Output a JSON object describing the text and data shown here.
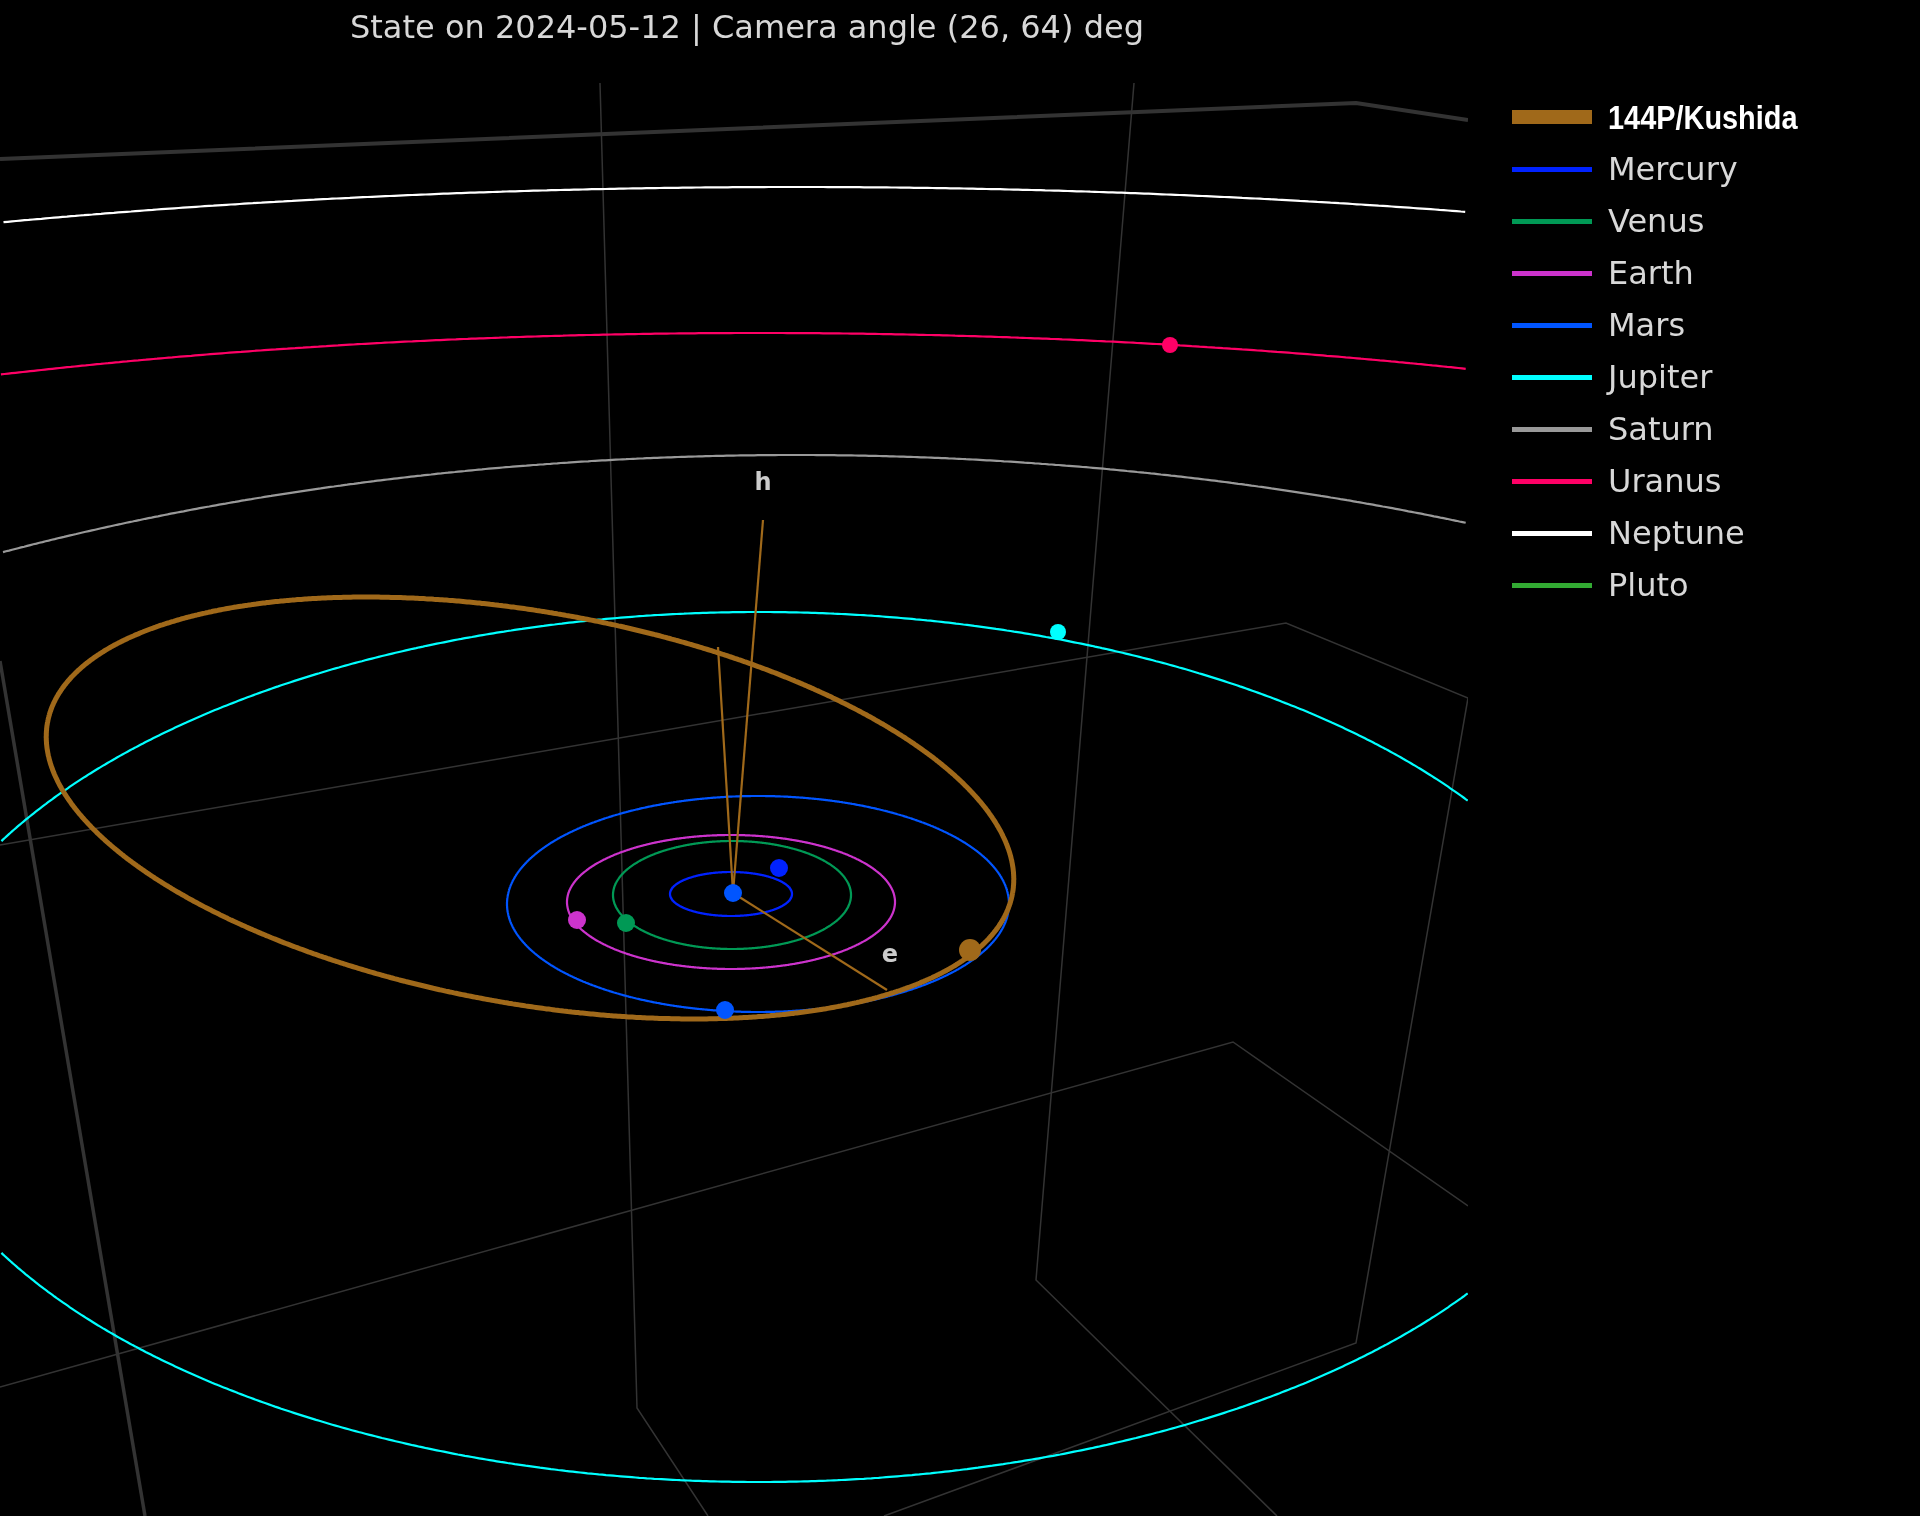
{
  "title": "State on 2024-05-12 | Camera angle (26, 64) deg",
  "axis_labels": [
    {
      "kind": "h",
      "text": "h"
    },
    {
      "kind": "e",
      "text": "e"
    }
  ],
  "legend": [
    {
      "name": "144P/Kushida",
      "color": "#a0691a",
      "highlighted": true
    },
    {
      "name": "Mercury",
      "color": "#0022ff",
      "highlighted": false
    },
    {
      "name": "Venus",
      "color": "#009955",
      "highlighted": false
    },
    {
      "name": "Earth",
      "color": "#cc33cc",
      "highlighted": false
    },
    {
      "name": "Mars",
      "color": "#0055ff",
      "highlighted": false
    },
    {
      "name": "Jupiter",
      "color": "#00ffff",
      "highlighted": false
    },
    {
      "name": "Saturn",
      "color": "#999999",
      "highlighted": false
    },
    {
      "name": "Uranus",
      "color": "#ff0066",
      "highlighted": false
    },
    {
      "name": "Neptune",
      "color": "#ffffff",
      "highlighted": false
    },
    {
      "name": "Pluto",
      "color": "#33aa33",
      "highlighted": false
    }
  ]
}
